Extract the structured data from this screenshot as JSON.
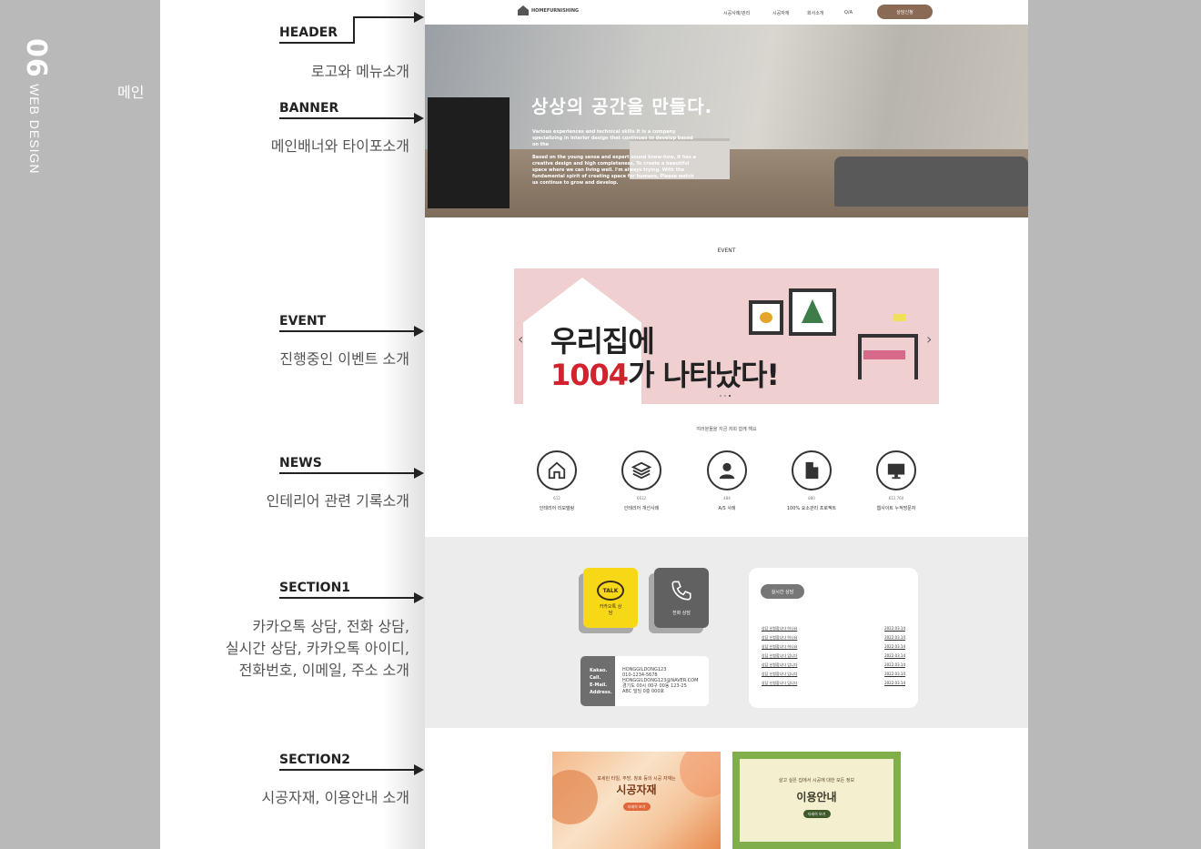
{
  "portfolio": {
    "number": "06",
    "label": "WEB DESIGN",
    "page_label": "메인"
  },
  "sections": [
    {
      "title": "HEADER",
      "desc": "로고와 메뉴소개"
    },
    {
      "title": "BANNER",
      "desc": "메인배너와 타이포소개"
    },
    {
      "title": "EVENT",
      "desc": "진행중인 이벤트 소개"
    },
    {
      "title": "NEWS",
      "desc": "인테리어 관련 기록소개"
    },
    {
      "title": "SECTION1",
      "desc1": "카카오톡 상담, 전화 상담,",
      "desc2": "실시간 상담, 카카오톡 아이디,",
      "desc3": "전화번호, 이메일, 주소 소개"
    },
    {
      "title": "SECTION2",
      "desc": "시공자재, 이용안내 소개"
    }
  ],
  "site": {
    "logo": "HOMEFURNISHING",
    "nav": [
      "시공사례/관리",
      "시공자재",
      "회사소개",
      "Q/A"
    ],
    "nav_button": "상담신청",
    "banner_title": "상상의 공간을 만들다.",
    "banner_text1": "Various experiences and technical skills It is a company specializing in interior design that continues to develop based on the",
    "banner_text2": "Based on the young sense and expert sound know-how, it has a creative design and high completeness. To create a beautiful space where we can living well. I'm always trying. With the fundamental spirit of creating space for humans, Please watch us continue to grow and develop.",
    "event_title": "EVENT",
    "event_line1": "우리집에",
    "event_num": "1004",
    "event_line2": "가 나타났다!",
    "news_head": "여러분들을 지금 저희 함께 해요",
    "news": [
      {
        "num": "612",
        "label": "인테리어 리모델링",
        "icon": "house-icon"
      },
      {
        "num": "6612",
        "label": "인테리어 개선사례",
        "icon": "layers-icon"
      },
      {
        "num": "484",
        "label": "A/S 사례",
        "icon": "user-icon"
      },
      {
        "num": "880",
        "label": "100% 요소관리 프로젝트",
        "icon": "document-icon"
      },
      {
        "num": "612,760",
        "label": "웹사이트 누적방문자",
        "icon": "monitor-icon"
      }
    ],
    "kakao_label": "TALK",
    "kakao_text": "카카오톡 상담",
    "phone_text": "전화 상담",
    "info_labels": [
      "Kakao.",
      "Call.",
      "E-Mail.",
      "Address."
    ],
    "info_values": [
      "HONGGILDONG123",
      "010-1234-5678",
      "HONGGILDONG123@NAVER.COM",
      "경기도 00시 00구 00동 123-25",
      "ABC 빌딩 0층 000호"
    ],
    "consult_title": "실시간 상담",
    "consult_rows": [
      {
        "text": "상담 신청합니다 하나요",
        "date": "2022.03.14"
      },
      {
        "text": "상담 신청합니다 하나요",
        "date": "2022.03.14"
      },
      {
        "text": "상담 신청합니다 하나요",
        "date": "2022.03.14"
      },
      {
        "text": "상담 신청합니다 입니다",
        "date": "2022.03.14"
      },
      {
        "text": "상담 신청합니다 입니다",
        "date": "2022.03.14"
      },
      {
        "text": "상담 신청합니다 입니다",
        "date": "2022.03.14"
      },
      {
        "text": "상담 신청합니다 입니다",
        "date": "2022.03.14"
      }
    ],
    "card1_small": "포세린 타일, 주방, 창호 등의 시공 자재는",
    "card1_title": "시공자재",
    "card1_btn": "자세히 보기",
    "card2_small": "살고 싶은 집에서 시공에 대한 모든 정보",
    "card2_title": "이용안내",
    "card2_btn": "자세히 보기"
  }
}
